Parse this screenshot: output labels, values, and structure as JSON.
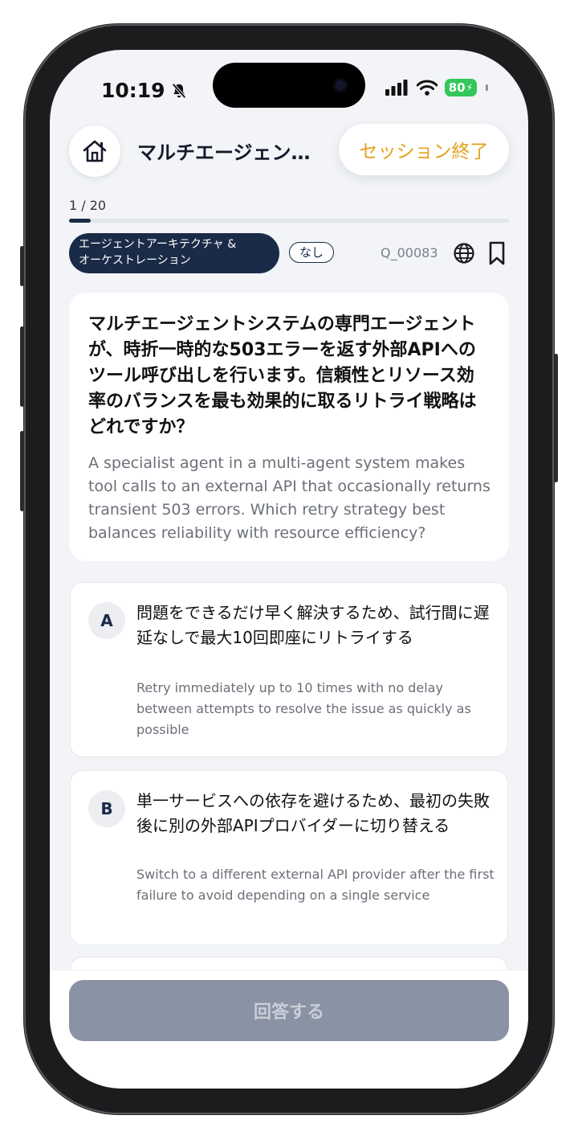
{
  "status_bar": {
    "time": "10:19",
    "battery": "80",
    "icons": [
      "bell-slash-icon",
      "cellular-signal-icon",
      "wifi-icon",
      "battery-icon"
    ]
  },
  "header": {
    "title": "マルチエージェン…",
    "end_session_label": "セッション終了",
    "home_icon": "home-icon"
  },
  "progress": {
    "label": "1 / 20",
    "current": 1,
    "total": 20
  },
  "tags": {
    "category_line1": "エージェントアーキテクチャ &",
    "category_line2": "オーケストレーション",
    "level": "なし",
    "question_id": "Q_00083",
    "icons": [
      "globe-icon",
      "bookmark-icon"
    ]
  },
  "question": {
    "jp": "マルチエージェントシステムの専門エージェントが、時折一時的な503エラーを返す外部APIへのツール呼び出しを行います。信頼性とリソース効率のバランスを最も効果的に取るリトライ戦略はどれですか？",
    "en": "A specialist agent in a multi-agent system makes tool calls to an external API that occasionally returns transient 503 errors. Which retry strategy best balances reliability with resource efficiency?"
  },
  "options": [
    {
      "letter": "A",
      "jp": "問題をできるだけ早く解決するため、試行間に遅延なしで最大10回即座にリトライする",
      "en": "Retry immediately up to 10 times with no delay between attempts to resolve the issue as quickly as possible"
    },
    {
      "letter": "B",
      "jp": "単一サービスへの依存を避けるため、最初の失敗後に別の外部APIプロバイダーに切り替える",
      "en": "Switch to a different external API provider after the first failure to avoid depending on a single service"
    }
  ],
  "submit_label": "回答する",
  "colors": {
    "navy": "#1a2b47",
    "accent": "#e3a21a",
    "disabled_button": "#8a93a3",
    "background": "#f2f4f7"
  }
}
